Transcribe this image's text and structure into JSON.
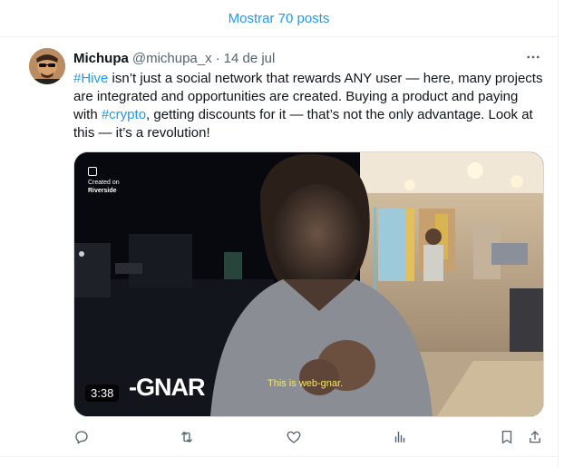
{
  "show_posts": {
    "label": "Mostrar 70 posts"
  },
  "tweet": {
    "name": "Michupa",
    "handle": "@michupa_x",
    "separator": "·",
    "time": "14 de jul",
    "text_parts": {
      "hashtag1": "#Hive",
      "part1": " isn’t just a social network that rewards ANY user — here, many projects are integrated and opportunities are created. Buying a product and paying with ",
      "hashtag2": "#crypto",
      "part2": ", getting discounts for it — that’s not the only advantage. Look at this — it’s a revolution!"
    },
    "media": {
      "watermark_line1": "Created on",
      "watermark_line2": "Riverside",
      "logo_text": "-GNAR",
      "caption": "This is web-gnar.",
      "duration": "3:38"
    },
    "actions": [
      "reply-icon",
      "repost-icon",
      "like-icon",
      "views-icon",
      "bookmark-icon",
      "share-icon"
    ]
  },
  "colors": {
    "link": "#1d9bf0",
    "muted": "#536471",
    "text": "#0f1419",
    "caption": "#f5e86a"
  }
}
